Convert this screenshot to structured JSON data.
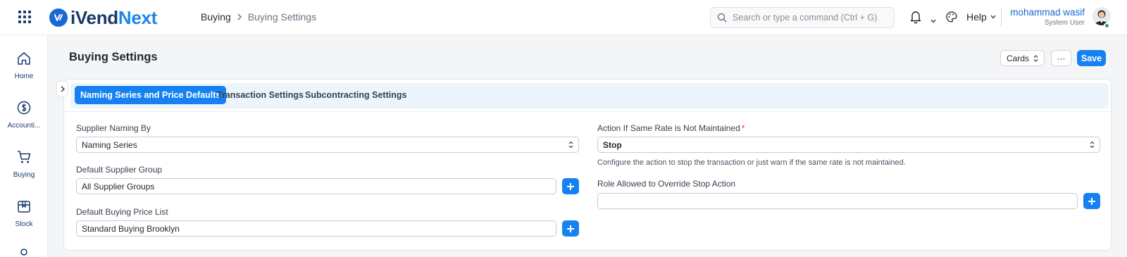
{
  "navbar": {
    "brand_a": "iVend",
    "brand_b": "Next",
    "breadcrumb": [
      "Buying",
      "Buying Settings"
    ],
    "search_placeholder": "Search or type a command (Ctrl + G)",
    "help_label": "Help",
    "user_name": "mohammad wasif",
    "user_role": "System User"
  },
  "sidebar": {
    "items": [
      {
        "label": "Home",
        "icon": "home-icon"
      },
      {
        "label": "Accounti...",
        "icon": "dollar-icon"
      },
      {
        "label": "Buying",
        "icon": "cart-icon"
      },
      {
        "label": "Stock",
        "icon": "box-icon"
      }
    ]
  },
  "page": {
    "title": "Buying Settings",
    "cards_label": "Cards",
    "more_label": "···",
    "save_label": "Save"
  },
  "tabs": [
    {
      "label": "Naming Series and Price Defaults",
      "active": true
    },
    {
      "label": "Transaction Settings",
      "active": false
    },
    {
      "label": "Subcontracting Settings",
      "active": false
    }
  ],
  "form": {
    "supplier_naming": {
      "label": "Supplier Naming By",
      "value": "Naming Series"
    },
    "supplier_group": {
      "label": "Default Supplier Group",
      "value": "All Supplier Groups"
    },
    "price_list": {
      "label": "Default Buying Price List",
      "value": "Standard Buying Brooklyn"
    },
    "rate_action": {
      "label": "Action If Same Rate is Not Maintained",
      "required_mark": "*",
      "value": "Stop",
      "description": "Configure the action to stop the transaction or just warn if the same rate is not maintained."
    },
    "override_role": {
      "label": "Role Allowed to Override Stop Action",
      "value": ""
    }
  },
  "colors": {
    "primary": "#1682f2",
    "brand_dark": "#1a3a6b",
    "brand_light": "#1e86e8",
    "tab_bar_bg": "#eef4fb",
    "required": "#e03636"
  }
}
